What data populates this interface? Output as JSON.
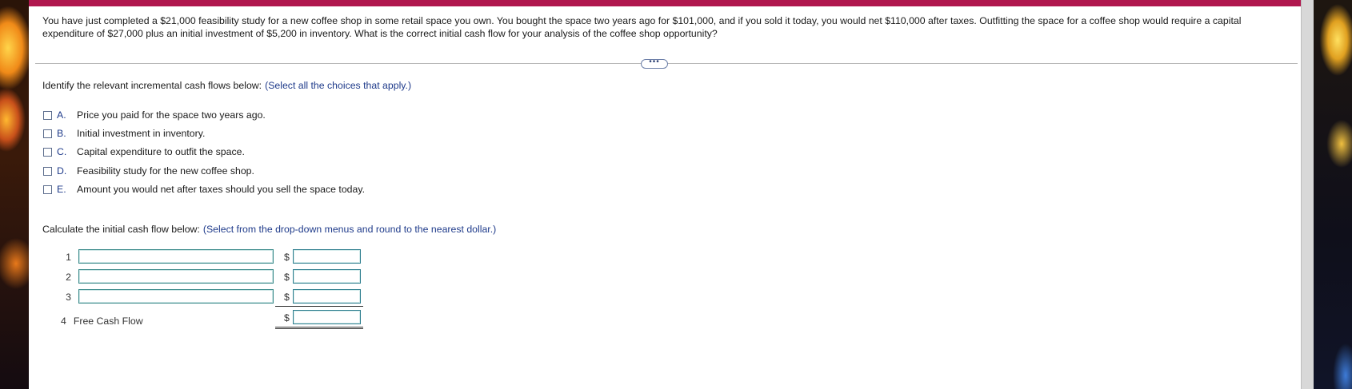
{
  "question": {
    "text": "You have just completed a $21,000 feasibility study for a new coffee shop in some retail space you own. You bought the space two years ago for $101,000, and if you sold it today, you would net $110,000 after taxes. Outfitting the space for a coffee shop would require a capital expenditure of $27,000 plus an initial investment of $5,200 in inventory. What is the correct initial cash flow for your analysis of the coffee shop opportunity?"
  },
  "expand_button": {
    "label": "•••"
  },
  "part1": {
    "prompt": "Identify the relevant incremental cash flows below:",
    "hint": "(Select all the choices that apply.)",
    "choices": [
      {
        "letter": "A.",
        "text": "Price you paid for the space two years ago.",
        "checked": false
      },
      {
        "letter": "B.",
        "text": "Initial investment in inventory.",
        "checked": false
      },
      {
        "letter": "C.",
        "text": "Capital expenditure to outfit the space.",
        "checked": false
      },
      {
        "letter": "D.",
        "text": "Feasibility study for the new coffee shop.",
        "checked": false
      },
      {
        "letter": "E.",
        "text": "Amount you would net after taxes should you sell the space today.",
        "checked": false
      }
    ]
  },
  "part2": {
    "prompt": "Calculate the initial cash flow below:",
    "hint": "(Select from the drop-down menus and round to the nearest dollar.)",
    "currency_symbol": "$",
    "rows": [
      {
        "num": "1",
        "dropdown_value": "",
        "amount": ""
      },
      {
        "num": "2",
        "dropdown_value": "",
        "amount": ""
      },
      {
        "num": "3",
        "dropdown_value": "",
        "amount": ""
      }
    ],
    "total": {
      "num": "4",
      "label": "Free Cash Flow",
      "amount": ""
    }
  },
  "colors": {
    "top_bar": "#b0174e",
    "hint_text": "#1e3a8a",
    "input_border": "#2f7f8f"
  }
}
